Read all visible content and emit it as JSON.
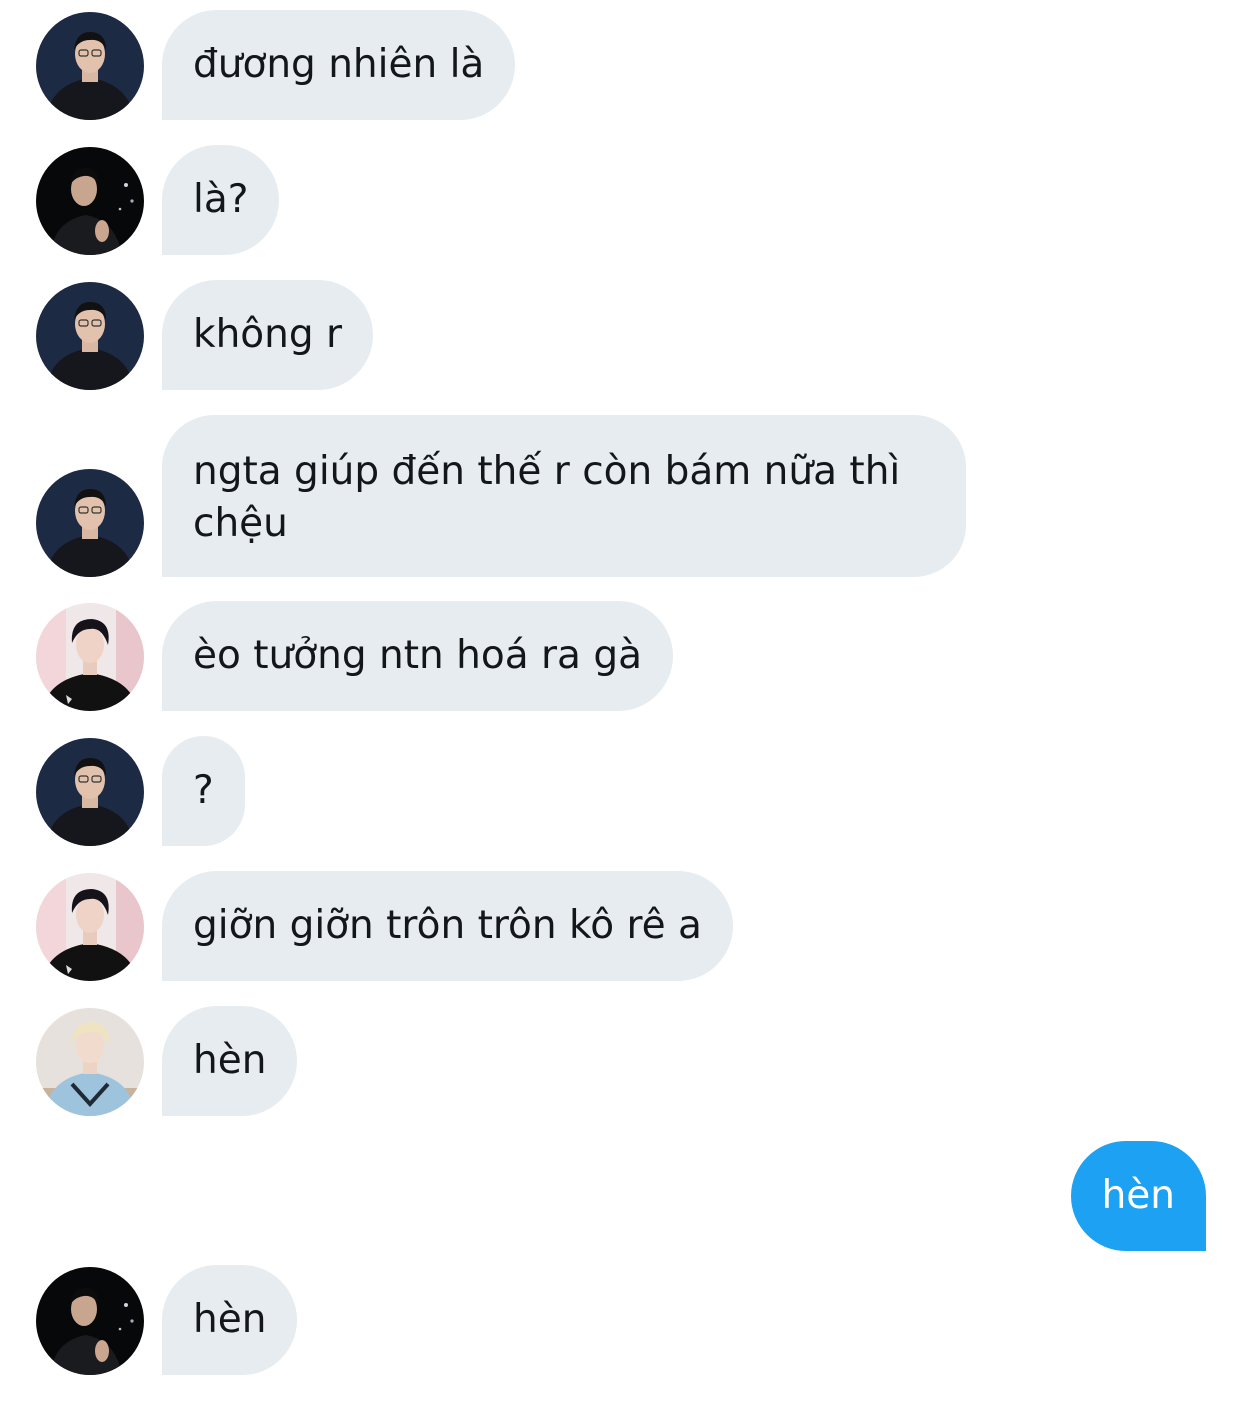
{
  "colors": {
    "incoming_bubble": "#e6ecf0",
    "outgoing_bubble": "#1da1f2",
    "incoming_text": "#14171a",
    "outgoing_text": "#ffffff"
  },
  "avatars": {
    "a": {
      "icon": "avatar-dark-hoodie-glasses"
    },
    "b": {
      "icon": "avatar-dark-night-hand"
    },
    "c": {
      "icon": "avatar-pink-background-black-shirt"
    },
    "d": {
      "icon": "avatar-blonde-light-blue-jacket"
    }
  },
  "messages": [
    {
      "sender": "a",
      "text": "đương nhiên là"
    },
    {
      "sender": "b",
      "text": "là?"
    },
    {
      "sender": "a",
      "text": "không r"
    },
    {
      "sender": "a",
      "text": "ngta giúp đến thế r còn bám nữa thì chệu"
    },
    {
      "sender": "c",
      "text": "èo tưởng ntn hoá ra gà"
    },
    {
      "sender": "a",
      "text": "?"
    },
    {
      "sender": "c",
      "text": "giỡn giỡn trôn trôn kô rê a"
    },
    {
      "sender": "d",
      "text": "hèn"
    },
    {
      "sender": "me",
      "text": "hèn"
    },
    {
      "sender": "b",
      "text": "hèn"
    }
  ]
}
